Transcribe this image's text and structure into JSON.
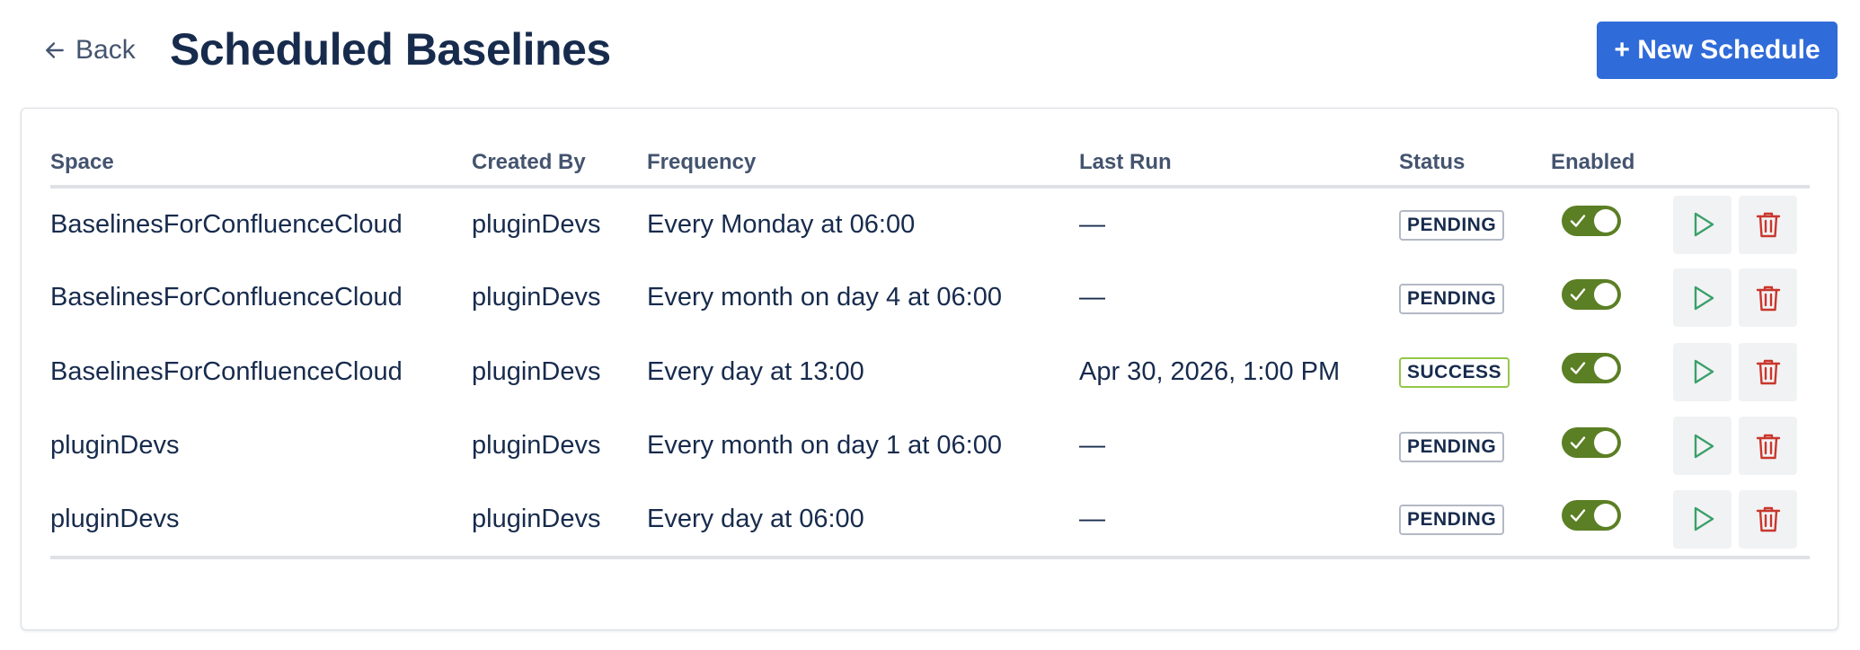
{
  "header": {
    "back_label": "Back",
    "title": "Scheduled Baselines",
    "new_schedule_label": "+ New Schedule"
  },
  "table": {
    "columns": [
      "Space",
      "Created By",
      "Frequency",
      "Last Run",
      "Status",
      "Enabled"
    ],
    "rows": [
      {
        "space": "BaselinesForConfluenceCloud",
        "created_by": "pluginDevs",
        "frequency": "Every Monday at 06:00",
        "last_run": "—",
        "status": "PENDING",
        "enabled": true
      },
      {
        "space": "BaselinesForConfluenceCloud",
        "created_by": "pluginDevs",
        "frequency": "Every month on day 4 at 06:00",
        "last_run": "—",
        "status": "PENDING",
        "enabled": true
      },
      {
        "space": "BaselinesForConfluenceCloud",
        "created_by": "pluginDevs",
        "frequency": "Every day at 13:00",
        "last_run": "Apr 30, 2026, 1:00 PM",
        "status": "SUCCESS",
        "enabled": true
      },
      {
        "space": "pluginDevs",
        "created_by": "pluginDevs",
        "frequency": "Every month on day 1 at 06:00",
        "last_run": "—",
        "status": "PENDING",
        "enabled": true
      },
      {
        "space": "pluginDevs",
        "created_by": "pluginDevs",
        "frequency": "Every day at 06:00",
        "last_run": "—",
        "status": "PENDING",
        "enabled": true
      }
    ]
  },
  "icons": {
    "back": "arrow-left-icon",
    "run": "play-icon",
    "delete": "trash-icon",
    "enabled": "check-icon"
  },
  "colors": {
    "primary": "#2f6bd9",
    "toggle_on": "#5b7f24",
    "run_icon": "#3aa06a",
    "delete_icon": "#c9372c",
    "success_border": "#94c748",
    "pending_border": "#b3b9c4"
  }
}
